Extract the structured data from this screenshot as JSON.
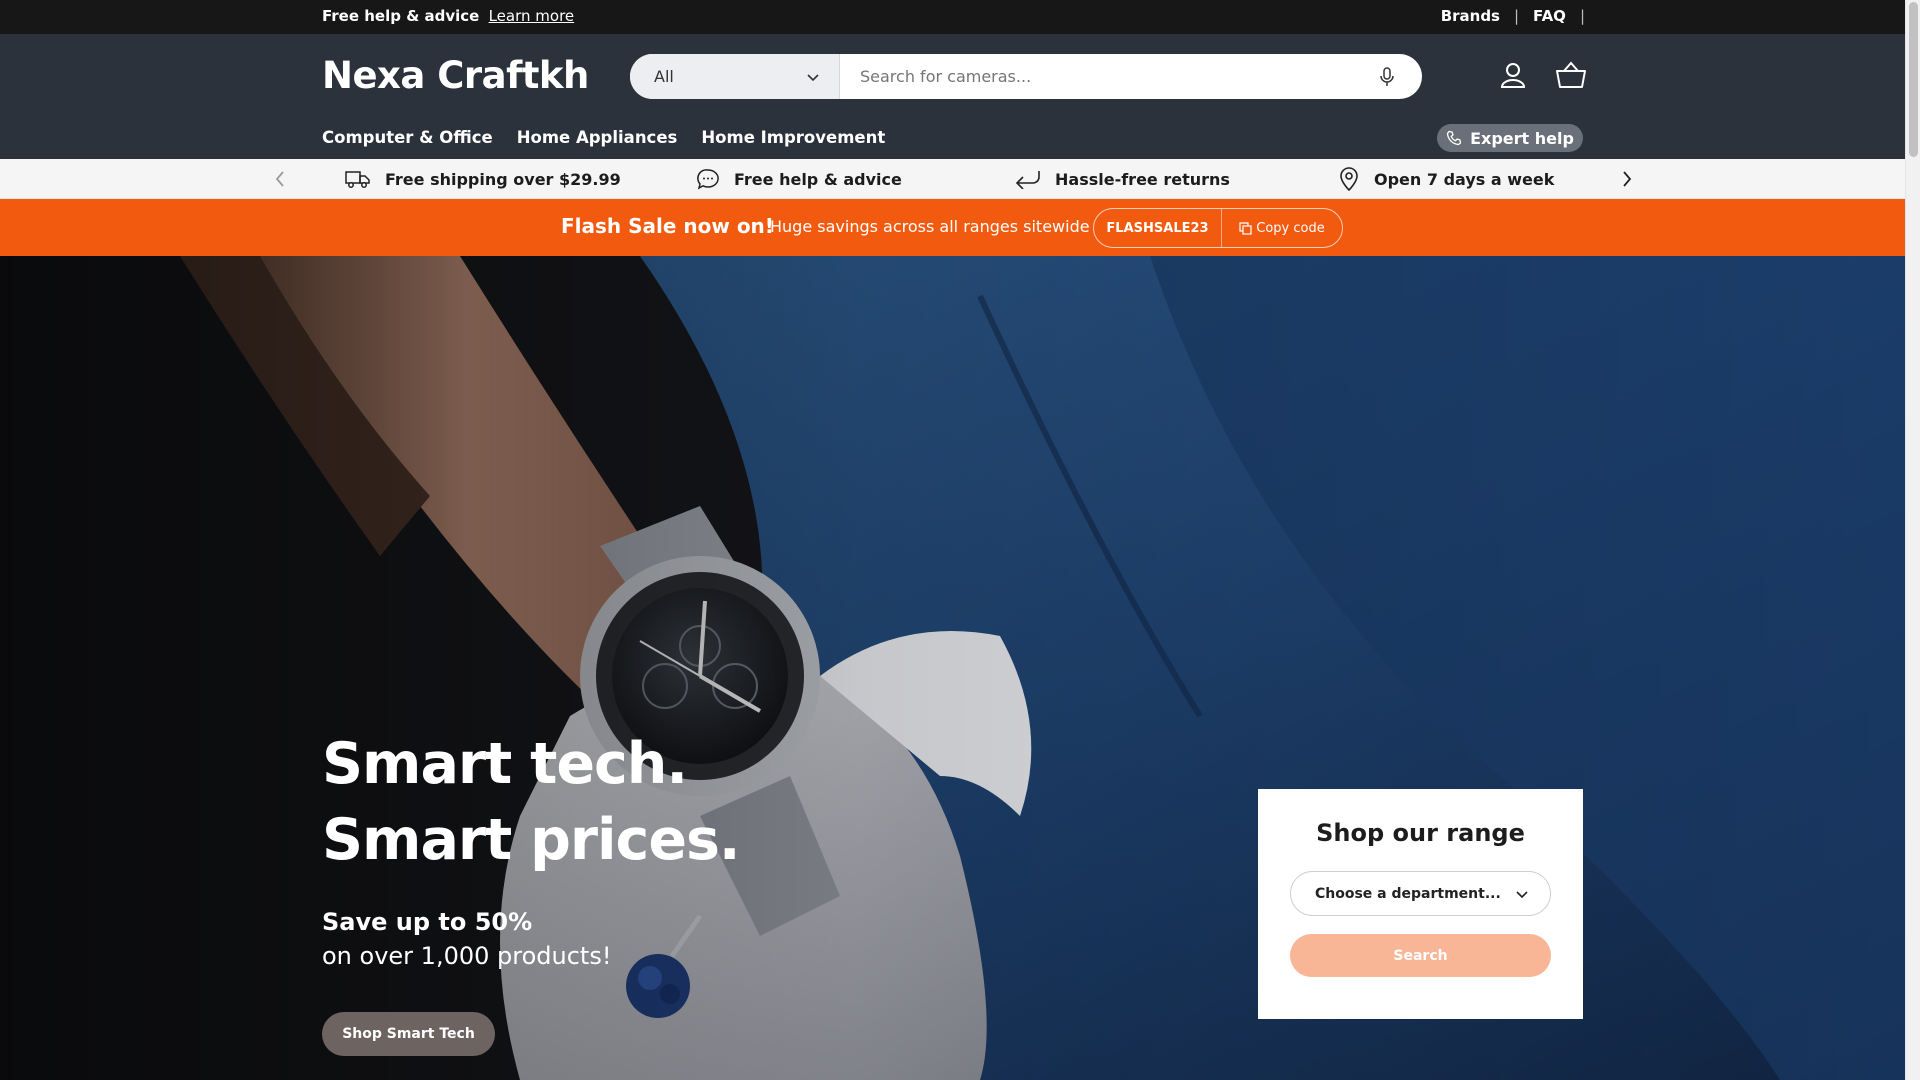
{
  "topbar": {
    "help_text": "Free help & advice",
    "learn_more": "Learn more",
    "brands": "Brands",
    "faq": "FAQ",
    "sep": "|"
  },
  "header": {
    "logo": "Nexa Craftkh",
    "category_selected": "All",
    "search_placeholder": "Search for cameras...",
    "icons": [
      "microphone-icon",
      "account-icon",
      "basket-icon"
    ],
    "nav": [
      "Computer & Office",
      "Home Appliances",
      "Home Improvement"
    ],
    "expert_help": "Expert help"
  },
  "usp": {
    "items": [
      {
        "icon": "truck-icon",
        "label": "Free shipping over $29.99"
      },
      {
        "icon": "chat-icon",
        "label": "Free help & advice"
      },
      {
        "icon": "return-arrow-icon",
        "label": "Hassle-free returns"
      },
      {
        "icon": "location-pin-icon",
        "label": "Open 7 days a week"
      }
    ]
  },
  "flash": {
    "title": "Flash Sale now on!",
    "subtitle": "Huge savings across all ranges sitewide",
    "code": "FLASHSALE23",
    "copy_label": "Copy code"
  },
  "hero": {
    "heading": "Smart tech. Smart prices.",
    "save": "Save up to 50%",
    "over": "on over 1,000 products!",
    "button": "Shop Smart Tech"
  },
  "range": {
    "title": "Shop our range",
    "select_placeholder": "Choose a department...",
    "search_button": "Search"
  },
  "colors": {
    "topbar": "#171717",
    "header": "#2b323b",
    "flash": "#f15a0f",
    "search_button": "#f9b697"
  }
}
